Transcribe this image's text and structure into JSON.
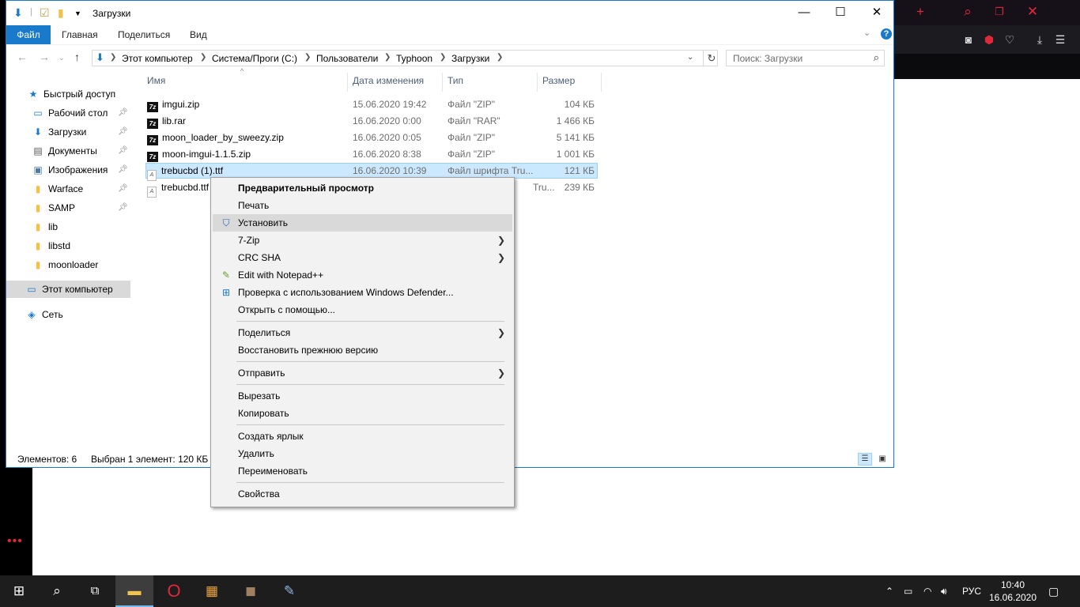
{
  "explorer": {
    "title": "Загрузки",
    "ribbon": {
      "file": "Файл",
      "home": "Главная",
      "share": "Поделиться",
      "view": "Вид",
      "help": "?"
    },
    "address": {
      "crumbs": [
        "Этот компьютер",
        "Система/Проги (C:)",
        "Пользователи",
        "Typhoon",
        "Загрузки"
      ]
    },
    "search": {
      "placeholder": "Поиск: Загрузки"
    },
    "nav": {
      "quick_access": "Быстрый доступ",
      "items": [
        "Рабочий стол",
        "Загрузки",
        "Документы",
        "Изображения",
        "Warface",
        "SAMP",
        "lib",
        "libstd",
        "moonloader"
      ],
      "this_pc": "Этот компьютер",
      "network": "Сеть"
    },
    "columns": {
      "name": "Имя",
      "date": "Дата изменения",
      "type": "Тип",
      "size": "Размер"
    },
    "files": [
      {
        "name": "imgui.zip",
        "date": "15.06.2020 19:42",
        "type": "Файл \"ZIP\"",
        "size": "104 КБ"
      },
      {
        "name": "lib.rar",
        "date": "16.06.2020 0:00",
        "type": "Файл \"RAR\"",
        "size": "1 466 КБ"
      },
      {
        "name": "moon_loader_by_sweezy.zip",
        "date": "16.06.2020 0:05",
        "type": "Файл \"ZIP\"",
        "size": "5 141 КБ"
      },
      {
        "name": "moon-imgui-1.1.5.zip",
        "date": "16.06.2020 8:38",
        "type": "Файл \"ZIP\"",
        "size": "1 001 КБ"
      },
      {
        "name": "trebucbd (1).ttf",
        "date": "16.06.2020 10:39",
        "type": "Файл шрифта Tru...",
        "size": "121 КБ"
      },
      {
        "name": "trebucbd.ttf",
        "date": "",
        "type": "Tru...",
        "size": "239 КБ"
      }
    ],
    "status": {
      "count": "Элементов: 6",
      "selected": "Выбран 1 элемент: 120 КБ"
    }
  },
  "context_menu": {
    "preview": "Предварительный просмотр",
    "print": "Печать",
    "install": "Установить",
    "zip7": "7-Zip",
    "crc": "CRC SHA",
    "notepad": "Edit with Notepad++",
    "defender": "Проверка с использованием Windows Defender...",
    "open_with": "Открыть с помощью...",
    "share": "Поделиться",
    "restore": "Восстановить прежнюю версию",
    "send_to": "Отправить",
    "cut": "Вырезать",
    "copy": "Копировать",
    "shortcut": "Создать ярлык",
    "delete": "Удалить",
    "rename": "Переименовать",
    "properties": "Свойства"
  },
  "taskbar": {
    "language": "РУС",
    "time": "10:40",
    "date": "16.06.2020"
  },
  "colors": {
    "accent": "#1979ca",
    "selection": "#cce8ff",
    "opera_red": "#e0283b",
    "taskbar": "#1d1d1d"
  }
}
